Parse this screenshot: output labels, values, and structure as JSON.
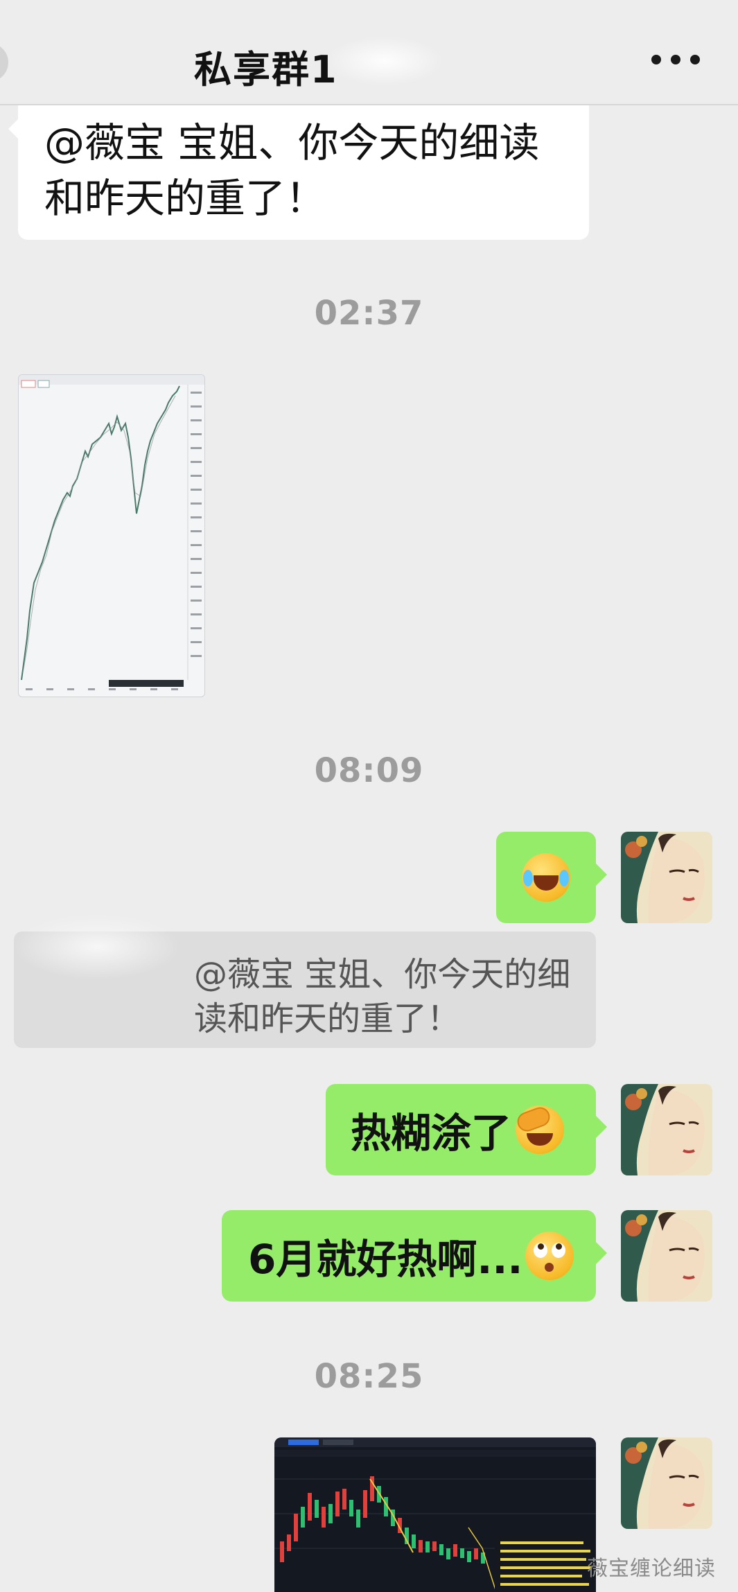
{
  "header": {
    "title": "私享群1"
  },
  "messages": {
    "top_bubble_text": "@薇宝 宝姐、你今天的细读和昨天的重了！",
    "time1": "02:37",
    "time2": "08:09",
    "quote_text": "@薇宝 宝姐、你今天的细读和昨天的重了！",
    "reply1": "热糊涂了",
    "reply2": "6月就好热啊...",
    "time3": "08:25"
  },
  "emoji": {
    "laugh": "face-with-tears-of-joy",
    "facepalm": "face-palm",
    "roll": "face-with-rolling-eyes"
  },
  "watermark": "薇宝缠论细读",
  "colors": {
    "green_bubble": "#95ec69",
    "background": "#ededed",
    "white_bubble": "#ffffff"
  }
}
